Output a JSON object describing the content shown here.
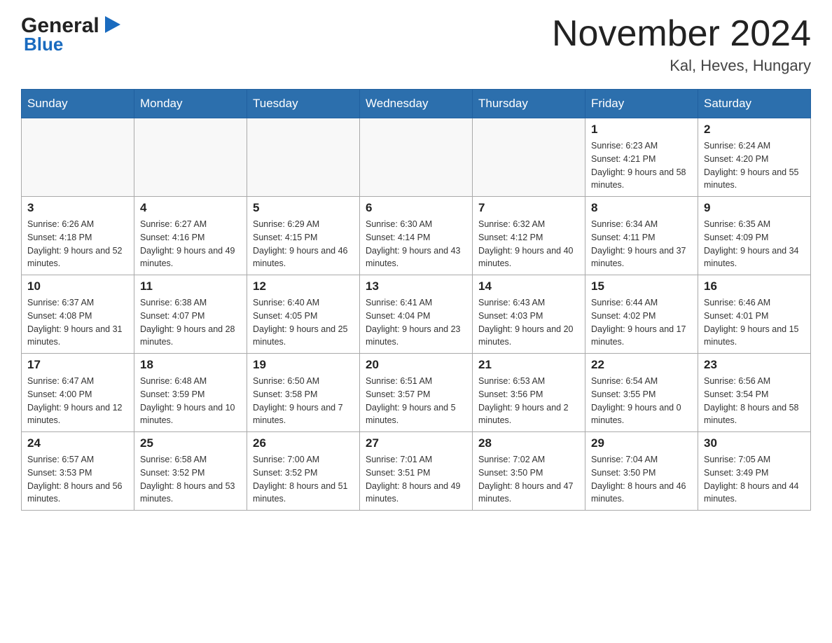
{
  "logo": {
    "general": "General",
    "blue": "Blue"
  },
  "header": {
    "month": "November 2024",
    "location": "Kal, Heves, Hungary"
  },
  "weekdays": [
    "Sunday",
    "Monday",
    "Tuesday",
    "Wednesday",
    "Thursday",
    "Friday",
    "Saturday"
  ],
  "weeks": [
    [
      {
        "day": "",
        "info": ""
      },
      {
        "day": "",
        "info": ""
      },
      {
        "day": "",
        "info": ""
      },
      {
        "day": "",
        "info": ""
      },
      {
        "day": "",
        "info": ""
      },
      {
        "day": "1",
        "info": "Sunrise: 6:23 AM\nSunset: 4:21 PM\nDaylight: 9 hours and 58 minutes."
      },
      {
        "day": "2",
        "info": "Sunrise: 6:24 AM\nSunset: 4:20 PM\nDaylight: 9 hours and 55 minutes."
      }
    ],
    [
      {
        "day": "3",
        "info": "Sunrise: 6:26 AM\nSunset: 4:18 PM\nDaylight: 9 hours and 52 minutes."
      },
      {
        "day": "4",
        "info": "Sunrise: 6:27 AM\nSunset: 4:16 PM\nDaylight: 9 hours and 49 minutes."
      },
      {
        "day": "5",
        "info": "Sunrise: 6:29 AM\nSunset: 4:15 PM\nDaylight: 9 hours and 46 minutes."
      },
      {
        "day": "6",
        "info": "Sunrise: 6:30 AM\nSunset: 4:14 PM\nDaylight: 9 hours and 43 minutes."
      },
      {
        "day": "7",
        "info": "Sunrise: 6:32 AM\nSunset: 4:12 PM\nDaylight: 9 hours and 40 minutes."
      },
      {
        "day": "8",
        "info": "Sunrise: 6:34 AM\nSunset: 4:11 PM\nDaylight: 9 hours and 37 minutes."
      },
      {
        "day": "9",
        "info": "Sunrise: 6:35 AM\nSunset: 4:09 PM\nDaylight: 9 hours and 34 minutes."
      }
    ],
    [
      {
        "day": "10",
        "info": "Sunrise: 6:37 AM\nSunset: 4:08 PM\nDaylight: 9 hours and 31 minutes."
      },
      {
        "day": "11",
        "info": "Sunrise: 6:38 AM\nSunset: 4:07 PM\nDaylight: 9 hours and 28 minutes."
      },
      {
        "day": "12",
        "info": "Sunrise: 6:40 AM\nSunset: 4:05 PM\nDaylight: 9 hours and 25 minutes."
      },
      {
        "day": "13",
        "info": "Sunrise: 6:41 AM\nSunset: 4:04 PM\nDaylight: 9 hours and 23 minutes."
      },
      {
        "day": "14",
        "info": "Sunrise: 6:43 AM\nSunset: 4:03 PM\nDaylight: 9 hours and 20 minutes."
      },
      {
        "day": "15",
        "info": "Sunrise: 6:44 AM\nSunset: 4:02 PM\nDaylight: 9 hours and 17 minutes."
      },
      {
        "day": "16",
        "info": "Sunrise: 6:46 AM\nSunset: 4:01 PM\nDaylight: 9 hours and 15 minutes."
      }
    ],
    [
      {
        "day": "17",
        "info": "Sunrise: 6:47 AM\nSunset: 4:00 PM\nDaylight: 9 hours and 12 minutes."
      },
      {
        "day": "18",
        "info": "Sunrise: 6:48 AM\nSunset: 3:59 PM\nDaylight: 9 hours and 10 minutes."
      },
      {
        "day": "19",
        "info": "Sunrise: 6:50 AM\nSunset: 3:58 PM\nDaylight: 9 hours and 7 minutes."
      },
      {
        "day": "20",
        "info": "Sunrise: 6:51 AM\nSunset: 3:57 PM\nDaylight: 9 hours and 5 minutes."
      },
      {
        "day": "21",
        "info": "Sunrise: 6:53 AM\nSunset: 3:56 PM\nDaylight: 9 hours and 2 minutes."
      },
      {
        "day": "22",
        "info": "Sunrise: 6:54 AM\nSunset: 3:55 PM\nDaylight: 9 hours and 0 minutes."
      },
      {
        "day": "23",
        "info": "Sunrise: 6:56 AM\nSunset: 3:54 PM\nDaylight: 8 hours and 58 minutes."
      }
    ],
    [
      {
        "day": "24",
        "info": "Sunrise: 6:57 AM\nSunset: 3:53 PM\nDaylight: 8 hours and 56 minutes."
      },
      {
        "day": "25",
        "info": "Sunrise: 6:58 AM\nSunset: 3:52 PM\nDaylight: 8 hours and 53 minutes."
      },
      {
        "day": "26",
        "info": "Sunrise: 7:00 AM\nSunset: 3:52 PM\nDaylight: 8 hours and 51 minutes."
      },
      {
        "day": "27",
        "info": "Sunrise: 7:01 AM\nSunset: 3:51 PM\nDaylight: 8 hours and 49 minutes."
      },
      {
        "day": "28",
        "info": "Sunrise: 7:02 AM\nSunset: 3:50 PM\nDaylight: 8 hours and 47 minutes."
      },
      {
        "day": "29",
        "info": "Sunrise: 7:04 AM\nSunset: 3:50 PM\nDaylight: 8 hours and 46 minutes."
      },
      {
        "day": "30",
        "info": "Sunrise: 7:05 AM\nSunset: 3:49 PM\nDaylight: 8 hours and 44 minutes."
      }
    ]
  ]
}
